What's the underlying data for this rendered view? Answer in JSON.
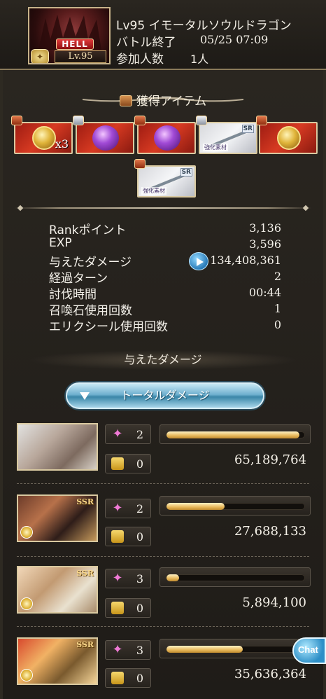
{
  "header": {
    "boss_tag": "HELL",
    "boss_level": "Lv.95",
    "title": "Lv95 イモータルソウルドラゴン",
    "battle_end_label": "バトル終了",
    "battle_end_value": "05/25 07:09",
    "participants_label": "参加人数",
    "participants_value": "1人"
  },
  "loot": {
    "title": "獲得アイテム",
    "items": [
      {
        "type": "coin",
        "count": "x3",
        "bg": "red",
        "chest": "red"
      },
      {
        "type": "orb",
        "bg": "red",
        "chest": "silver"
      },
      {
        "type": "orb",
        "bg": "red",
        "chest": "red"
      },
      {
        "type": "sword",
        "bg": "gray",
        "chest": "silver",
        "rarity": "SR",
        "tag": "強化素材"
      },
      {
        "type": "coin",
        "bg": "red",
        "chest": "red"
      },
      {
        "type": "sword",
        "bg": "gray",
        "chest": "red",
        "rarity": "SR",
        "tag": "強化素材"
      }
    ]
  },
  "stats": [
    {
      "label": "Rankポイント",
      "value": "3,136"
    },
    {
      "label": "EXP",
      "value": "3,596"
    },
    {
      "label": "与えたダメージ",
      "value": "134,408,361"
    },
    {
      "label": "経過ターン",
      "value": "2"
    },
    {
      "label": "討伐時間",
      "value": "00:44"
    },
    {
      "label": "召喚石使用回数",
      "value": "1"
    },
    {
      "label": "エリクシール使用回数",
      "value": "0"
    }
  ],
  "damage_section": {
    "title": "与えたダメージ",
    "toggle_label": "トータルダメージ"
  },
  "characters": [
    {
      "ssr": "",
      "skill_count": "2",
      "ca_count": "0",
      "damage": "65,189,764",
      "bar_fraction": 0.96
    },
    {
      "ssr": "SSR",
      "skill_count": "2",
      "ca_count": "0",
      "damage": "27,688,133",
      "bar_fraction": 0.42
    },
    {
      "ssr": "SSR",
      "skill_count": "3",
      "ca_count": "0",
      "damage": "5,894,100",
      "bar_fraction": 0.09
    },
    {
      "ssr": "SSR",
      "skill_count": "3",
      "ca_count": "0",
      "damage": "35,636,364",
      "bar_fraction": 0.55
    }
  ],
  "chat": {
    "label": "Chat"
  },
  "colors": {
    "accent_blue": "#3a86a8",
    "bar_gold": "#e7b85a",
    "frame_gold": "#d9c9a0"
  }
}
